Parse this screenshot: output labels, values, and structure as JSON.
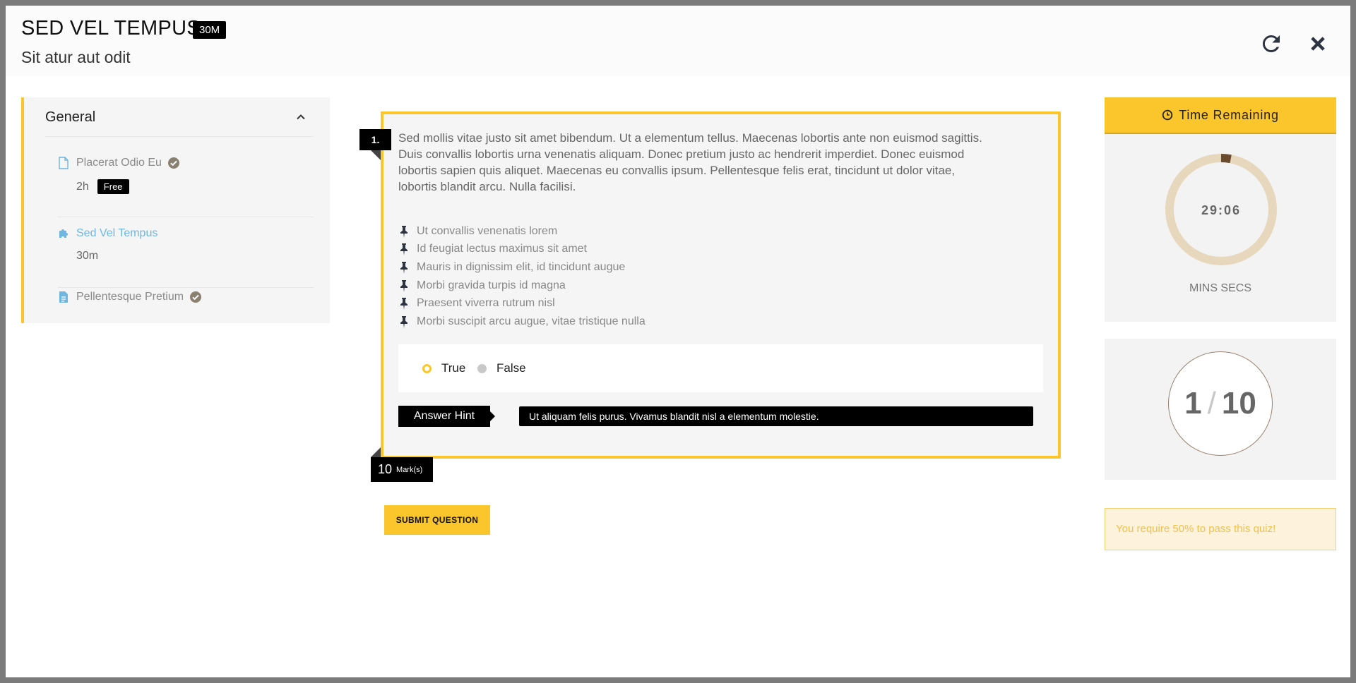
{
  "header": {
    "title": "SED VEL TEMPUS",
    "duration_badge": "30M",
    "subtitle": "Sit atur aut odit",
    "refresh_icon": "refresh-icon",
    "close_icon": "close-icon"
  },
  "sidebar": {
    "section_label": "General",
    "lessons": [
      {
        "title": "Placerat Odio Eu",
        "meta": "2h",
        "badge": "Free",
        "icon": "document-icon",
        "completed": true
      },
      {
        "title": "Sed Vel Tempus",
        "meta": "30m",
        "icon": "puzzle-icon",
        "active": true
      },
      {
        "title": "Pellentesque Pretium",
        "icon": "document-text-icon",
        "completed": true
      }
    ]
  },
  "question": {
    "number": "1.",
    "text": "Sed mollis vitae justo sit amet bibendum. Ut a elementum tellus. Maecenas lobortis ante non euismod sagittis. Duis convallis lobortis urna venenatis aliquam. Donec pretium justo ac hendrerit imperdiet. Donec euismod lobortis sapien quis aliquet. Maecenas eu convallis ipsum. Pellentesque felis erat, tincidunt ut dolor vitae, lobortis blandit arcu. Nulla facilisi.",
    "bullets": [
      "Ut convallis venenatis lorem",
      "Id feugiat lectus maximus sit amet",
      "Mauris in dignissim elit, id tincidunt augue",
      "Morbi gravida turpis id magna",
      "Praesent viverra rutrum nisl",
      "Morbi suscipit arcu augue, vitae tristique nulla"
    ],
    "options": [
      {
        "label": "True",
        "selected": true
      },
      {
        "label": "False",
        "selected": false
      }
    ],
    "hint_label": "Answer Hint",
    "hint_text": "Ut aliquam felis purus. Vivamus blandit nisl a elementum molestie.",
    "marks": "10",
    "marks_label": "Mark(s)",
    "submit_label": "SUBMIT QUESTION"
  },
  "timer": {
    "header": "Time Remaining",
    "time": "29:06",
    "label": "MINS SECS",
    "progress_fraction": 0.03
  },
  "progress": {
    "current": "1",
    "separator": "/",
    "total": "10"
  },
  "pass_note": "You require 50% to pass this quiz!",
  "colors": {
    "accent": "#fbc62c",
    "active_link": "#6fb6e0",
    "ring_track": "#e7d7bd",
    "ring_progress": "#6b4a2e"
  }
}
